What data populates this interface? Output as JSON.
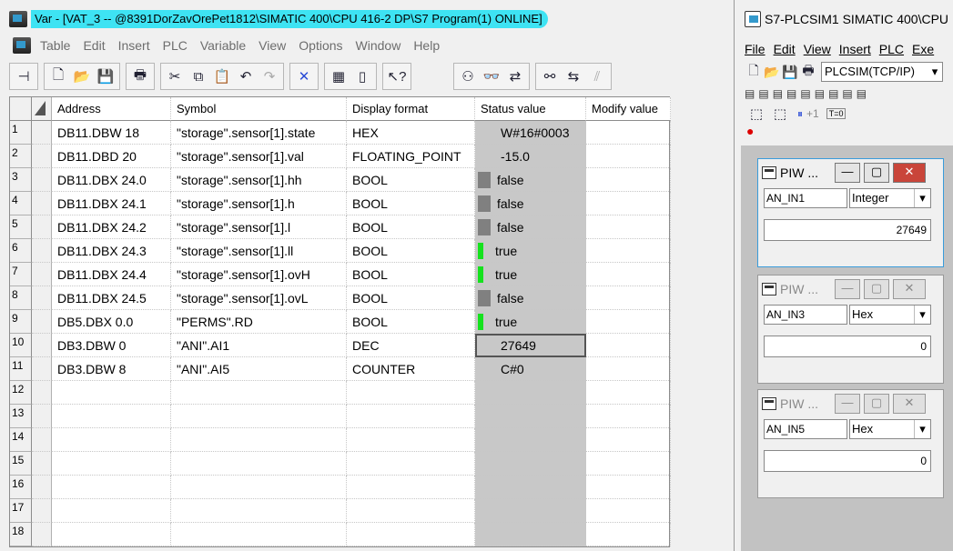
{
  "vat": {
    "title": "Var - [VAT_3 -- @8391DorZavOrePet1812\\SIMATIC 400\\CPU 416-2 DP\\S7 Program(1)  ONLINE]",
    "menu": [
      "Table",
      "Edit",
      "Insert",
      "PLC",
      "Variable",
      "View",
      "Options",
      "Window",
      "Help"
    ],
    "columns": {
      "address": "Address",
      "symbol": "Symbol",
      "display_format": "Display format",
      "status_value": "Status value",
      "modify_value": "Modify value"
    },
    "rows": [
      {
        "num": "1",
        "address": "DB11.DBW  18",
        "symbol": "\"storage\".sensor[1].state",
        "format": "HEX",
        "status": "W#16#0003",
        "indicator": "none"
      },
      {
        "num": "2",
        "address": "DB11.DBD  20",
        "symbol": "\"storage\".sensor[1].val",
        "format": "FLOATING_POINT",
        "status": "-15.0",
        "indicator": "none"
      },
      {
        "num": "3",
        "address": "DB11.DBX  24.0",
        "symbol": "\"storage\".sensor[1].hh",
        "format": "BOOL",
        "status": "false",
        "indicator": "grey"
      },
      {
        "num": "4",
        "address": "DB11.DBX  24.1",
        "symbol": "\"storage\".sensor[1].h",
        "format": "BOOL",
        "status": "false",
        "indicator": "grey"
      },
      {
        "num": "5",
        "address": "DB11.DBX  24.2",
        "symbol": "\"storage\".sensor[1].l",
        "format": "BOOL",
        "status": "false",
        "indicator": "grey"
      },
      {
        "num": "6",
        "address": "DB11.DBX  24.3",
        "symbol": "\"storage\".sensor[1].ll",
        "format": "BOOL",
        "status": "true",
        "indicator": "green"
      },
      {
        "num": "7",
        "address": "DB11.DBX  24.4",
        "symbol": "\"storage\".sensor[1].ovH",
        "format": "BOOL",
        "status": "true",
        "indicator": "green"
      },
      {
        "num": "8",
        "address": "DB11.DBX  24.5",
        "symbol": "\"storage\".sensor[1].ovL",
        "format": "BOOL",
        "status": "false",
        "indicator": "grey"
      },
      {
        "num": "9",
        "address": "DB5.DBX    0.0",
        "symbol": "\"PERMS\".RD",
        "format": "BOOL",
        "status": "true",
        "indicator": "green"
      },
      {
        "num": "10",
        "address": "DB3.DBW    0",
        "symbol": "\"ANI\".AI1",
        "format": "DEC",
        "status": "27649",
        "indicator": "none",
        "selected": true
      },
      {
        "num": "11",
        "address": "DB3.DBW    8",
        "symbol": "\"ANI\".AI5",
        "format": "COUNTER",
        "status": "C#0",
        "indicator": "none"
      },
      {
        "num": "12",
        "address": "",
        "symbol": "",
        "format": "",
        "status": "",
        "indicator": "none"
      },
      {
        "num": "13",
        "address": "",
        "symbol": "",
        "format": "",
        "status": "",
        "indicator": "none"
      },
      {
        "num": "14",
        "address": "",
        "symbol": "",
        "format": "",
        "status": "",
        "indicator": "none"
      },
      {
        "num": "15",
        "address": "",
        "symbol": "",
        "format": "",
        "status": "",
        "indicator": "none"
      },
      {
        "num": "16",
        "address": "",
        "symbol": "",
        "format": "",
        "status": "",
        "indicator": "none"
      },
      {
        "num": "17",
        "address": "",
        "symbol": "",
        "format": "",
        "status": "",
        "indicator": "none"
      },
      {
        "num": "18",
        "address": "",
        "symbol": "",
        "format": "",
        "status": "",
        "indicator": "none"
      }
    ],
    "colors": {
      "title_highlight": "#3ee3f3",
      "status_column": "#c8c8c8",
      "indicator_true": "#15e21e",
      "indicator_false": "#808080"
    }
  },
  "plcsim": {
    "title": "S7-PLCSIM1   SIMATIC 400\\CPU",
    "menu": [
      "File",
      "Edit",
      "View",
      "Insert",
      "PLC",
      "Exe"
    ],
    "connection": "PLCSIM(TCP/IP)",
    "tool_labels": {
      "plus_one": "+1",
      "t0": "T=0"
    },
    "windows": [
      {
        "title": "PIW ...",
        "address": "AN_IN1",
        "format": "Integer",
        "value": "27649",
        "active": true
      },
      {
        "title": "PIW ...",
        "address": "AN_IN3",
        "format": "Hex",
        "value": "0",
        "active": false
      },
      {
        "title": "PIW ...",
        "address": "AN_IN5",
        "format": "Hex",
        "value": "0",
        "active": false
      }
    ]
  }
}
